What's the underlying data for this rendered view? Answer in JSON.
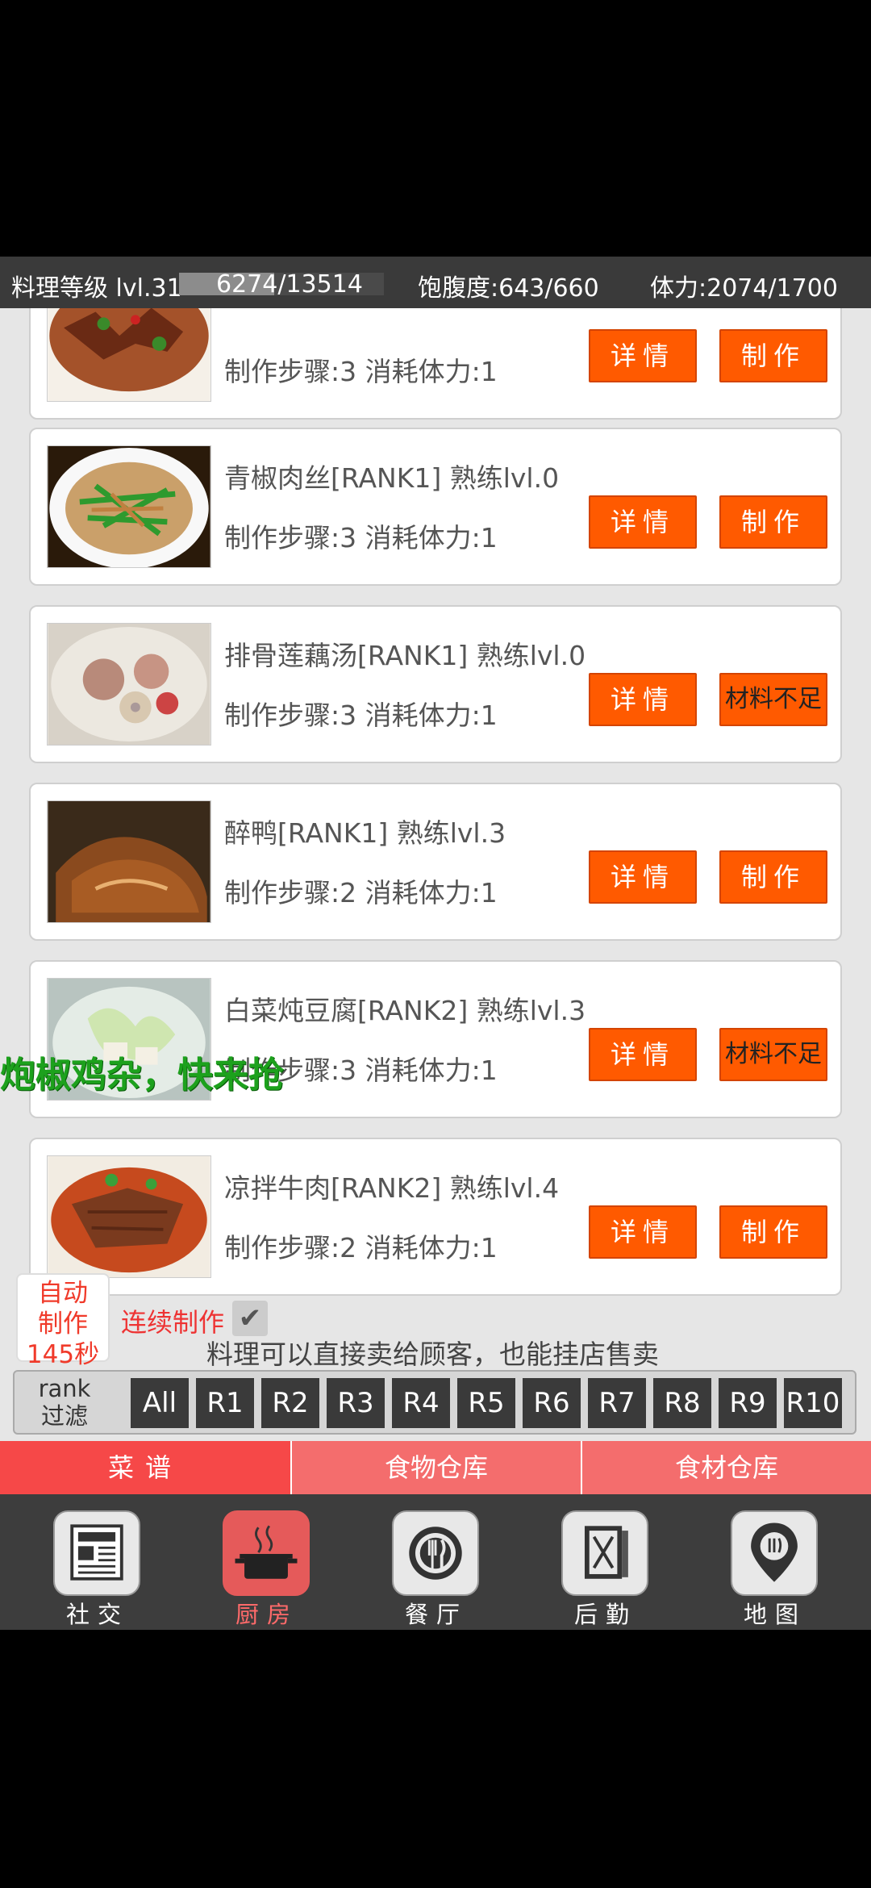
{
  "status": {
    "level": "料理等级 lvl.31",
    "xp_current": "6274",
    "xp_total": "/13514",
    "xp_fraction": 0.464,
    "satiety": "饱腹度:643/660",
    "stamina": "体力:2074/1700"
  },
  "recipes": [
    {
      "title": "",
      "info": "制作步骤:3  消耗体力:1",
      "detail": "详情",
      "make": "制作",
      "thumb": "spicy-pork"
    },
    {
      "title": "青椒肉丝[RANK1]  熟练lvl.0",
      "info": "制作步骤:3  消耗体力:1",
      "detail": "详情",
      "make": "制作",
      "thumb": "pepper-pork"
    },
    {
      "title": "排骨莲藕汤[RANK1]  熟练lvl.0",
      "info": "制作步骤:3  消耗体力:1",
      "detail": "详情",
      "make": "材料不足",
      "thumb": "rib-soup"
    },
    {
      "title": "醉鸭[RANK1]  熟练lvl.3",
      "info": "制作步骤:2  消耗体力:1",
      "detail": "详情",
      "make": "制作",
      "thumb": "drunk-duck"
    },
    {
      "title": "白菜炖豆腐[RANK2]  熟练lvl.3",
      "info": "制作步骤:3  消耗体力:1",
      "detail": "详情",
      "make": "材料不足",
      "thumb": "cabbage-tofu"
    },
    {
      "title": "凉拌牛肉[RANK2]  熟练lvl.4",
      "info": "制作步骤:2  消耗体力:1",
      "detail": "详情",
      "make": "制作",
      "thumb": "cold-beef"
    }
  ],
  "promo": "炮椒鸡杂，快来抢",
  "auto": {
    "line1": "自动",
    "line2": "制作",
    "line3": "145秒"
  },
  "continuous": "连续制作",
  "hint": "料理可以直接卖给顾客，也能挂店售卖",
  "filter": {
    "label1": "rank",
    "label2": "过滤",
    "buttons": [
      "All",
      "R1",
      "R2",
      "R3",
      "R4",
      "R5",
      "R6",
      "R7",
      "R8",
      "R9",
      "R10"
    ]
  },
  "tabs": [
    "菜谱",
    "食物仓库",
    "食材仓库"
  ],
  "nav": [
    {
      "label": "社交",
      "icon": "newspaper-icon"
    },
    {
      "label": "厨房",
      "icon": "pot-icon"
    },
    {
      "label": "餐厅",
      "icon": "plate-fork-icon"
    },
    {
      "label": "后勤",
      "icon": "menu-book-icon"
    },
    {
      "label": "地图",
      "icon": "map-pin-icon"
    }
  ],
  "colors": {
    "accent": "#ff5a00",
    "tab_active": "#f64848",
    "promo": "#1da11d"
  }
}
